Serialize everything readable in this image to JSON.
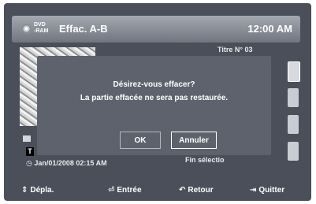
{
  "header": {
    "disc_label_1": "DVD",
    "disc_label_2": "-RAM",
    "title": "Effac. A-B",
    "time": "12:00 AM"
  },
  "background": {
    "title_label": "Titre N° 03",
    "t_badge": "T",
    "datetime": "Jan/01/2008 02:15 AM",
    "end_label": "Fin sélectio"
  },
  "dialog": {
    "line1": "Désirez-vous effacer?",
    "line2": "La partie effacée ne sera pas restaurée.",
    "ok_label": "OK",
    "cancel_label": "Annuler"
  },
  "footer": {
    "move_label": "Dépla.",
    "enter_label": "Entrée",
    "return_label": "Retour",
    "exit_label": "Quitter"
  },
  "icons": {
    "move": "updown-arrows-icon",
    "enter": "enter-icon",
    "return": "return-arrow-icon",
    "exit": "exit-icon"
  }
}
